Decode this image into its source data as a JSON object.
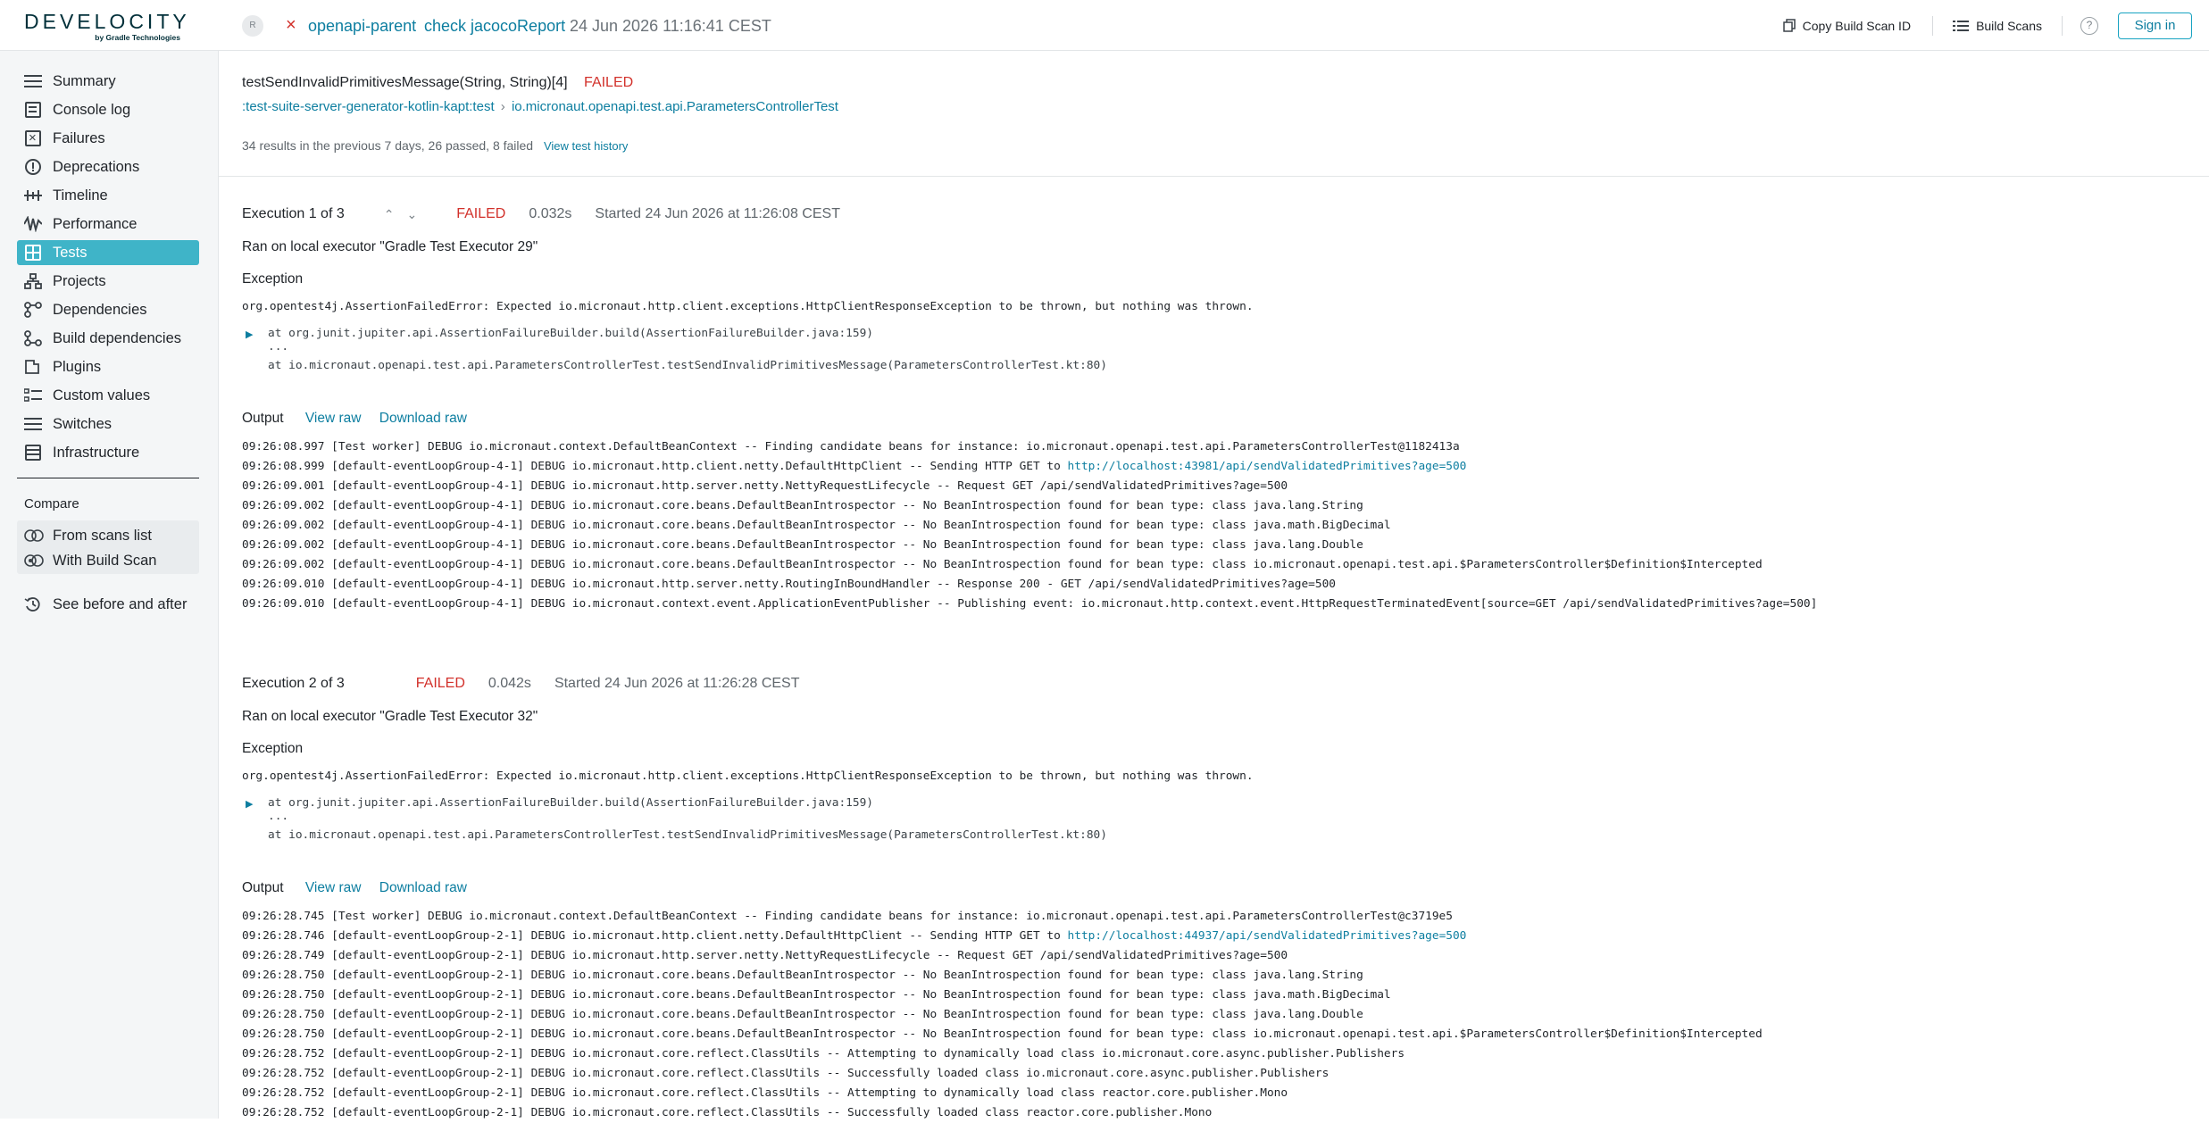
{
  "header": {
    "logo_text": "DEVELOCITY",
    "logo_sub": "by Gradle Technologies",
    "avatar": "R",
    "project": "openapi-parent",
    "tasks": "check jacocoReport",
    "timestamp": "24 Jun 2026 11:16:41 CEST",
    "copy_id": "Copy Build Scan ID",
    "build_scans": "Build Scans",
    "help": "?",
    "sign_in": "Sign in"
  },
  "sidebar": {
    "items": [
      {
        "label": "Summary",
        "icon": "summary-icon"
      },
      {
        "label": "Console log",
        "icon": "console-log-icon"
      },
      {
        "label": "Failures",
        "icon": "failures-icon"
      },
      {
        "label": "Deprecations",
        "icon": "deprecations-icon"
      },
      {
        "label": "Timeline",
        "icon": "timeline-icon"
      },
      {
        "label": "Performance",
        "icon": "performance-icon"
      },
      {
        "label": "Tests",
        "icon": "tests-icon"
      },
      {
        "label": "Projects",
        "icon": "projects-icon"
      },
      {
        "label": "Dependencies",
        "icon": "dependencies-icon"
      },
      {
        "label": "Build dependencies",
        "icon": "build-dependencies-icon"
      },
      {
        "label": "Plugins",
        "icon": "plugins-icon"
      },
      {
        "label": "Custom values",
        "icon": "custom-values-icon"
      },
      {
        "label": "Switches",
        "icon": "switches-icon"
      },
      {
        "label": "Infrastructure",
        "icon": "infrastructure-icon"
      }
    ],
    "active": "Tests",
    "compare": {
      "label": "Compare",
      "from_list": "From scans list",
      "with_scan": "With Build Scan",
      "before_after": "See before and after"
    }
  },
  "test": {
    "name": "testSendInvalidPrimitivesMessage(String, String)[4]",
    "status": "FAILED",
    "task_path": ":test-suite-server-generator-kotlin-kapt:test",
    "class_path": "io.micronaut.openapi.test.api.ParametersControllerTest",
    "history": "34 results in the previous 7 days, 26 passed, 8 failed",
    "history_link": "View test history"
  },
  "executions": [
    {
      "title": "Execution 1 of 3",
      "status": "FAILED",
      "duration": "0.032s",
      "started": "Started 24 Jun 2026 at 11:26:08 CEST",
      "executor": "Ran on local executor \"Gradle Test Executor 29\"",
      "exception_label": "Exception",
      "exception": "org.opentest4j.AssertionFailedError: Expected io.micronaut.http.client.exceptions.HttpClientResponseException to be thrown, but nothing was thrown.",
      "stack1": "at org.junit.jupiter.api.AssertionFailureBuilder.build(AssertionFailureBuilder.java:159)",
      "stack_ellipsis": "...",
      "stack2": "at io.micronaut.openapi.test.api.ParametersControllerTest.testSendInvalidPrimitivesMessage(ParametersControllerTest.kt:80)",
      "output_label": "Output",
      "view_raw": "View raw",
      "download_raw": "Download raw",
      "log": [
        {
          "pre": "09:26:08.997 [Test worker] DEBUG io.micronaut.context.DefaultBeanContext -- Finding candidate beans for instance: io.micronaut.openapi.test.api.ParametersControllerTest@1182413a",
          "link": "",
          "post": ""
        },
        {
          "pre": "09:26:08.999 [default-eventLoopGroup-4-1] DEBUG io.micronaut.http.client.netty.DefaultHttpClient -- Sending HTTP GET to ",
          "link": "http://localhost:43981/api/sendValidatedPrimitives?age=500",
          "post": ""
        },
        {
          "pre": "09:26:09.001 [default-eventLoopGroup-4-1] DEBUG io.micronaut.http.server.netty.NettyRequestLifecycle -- Request GET /api/sendValidatedPrimitives?age=500",
          "link": "",
          "post": ""
        },
        {
          "pre": "09:26:09.002 [default-eventLoopGroup-4-1] DEBUG io.micronaut.core.beans.DefaultBeanIntrospector -- No BeanIntrospection found for bean type: class java.lang.String",
          "link": "",
          "post": ""
        },
        {
          "pre": "09:26:09.002 [default-eventLoopGroup-4-1] DEBUG io.micronaut.core.beans.DefaultBeanIntrospector -- No BeanIntrospection found for bean type: class java.math.BigDecimal",
          "link": "",
          "post": ""
        },
        {
          "pre": "09:26:09.002 [default-eventLoopGroup-4-1] DEBUG io.micronaut.core.beans.DefaultBeanIntrospector -- No BeanIntrospection found for bean type: class java.lang.Double",
          "link": "",
          "post": ""
        },
        {
          "pre": "09:26:09.002 [default-eventLoopGroup-4-1] DEBUG io.micronaut.core.beans.DefaultBeanIntrospector -- No BeanIntrospection found for bean type: class io.micronaut.openapi.test.api.$ParametersController$Definition$Intercepted",
          "link": "",
          "post": ""
        },
        {
          "pre": "09:26:09.010 [default-eventLoopGroup-4-1] DEBUG io.micronaut.http.server.netty.RoutingInBoundHandler -- Response 200 - GET /api/sendValidatedPrimitives?age=500",
          "link": "",
          "post": ""
        },
        {
          "pre": "09:26:09.010 [default-eventLoopGroup-4-1] DEBUG io.micronaut.context.event.ApplicationEventPublisher -- Publishing event: io.micronaut.http.context.event.HttpRequestTerminatedEvent[source=GET /api/sendValidatedPrimitives?age=500]",
          "link": "",
          "post": ""
        }
      ]
    },
    {
      "title": "Execution 2 of 3",
      "status": "FAILED",
      "duration": "0.042s",
      "started": "Started 24 Jun 2026 at 11:26:28 CEST",
      "executor": "Ran on local executor \"Gradle Test Executor 32\"",
      "exception_label": "Exception",
      "exception": "org.opentest4j.AssertionFailedError: Expected io.micronaut.http.client.exceptions.HttpClientResponseException to be thrown, but nothing was thrown.",
      "stack1": "at org.junit.jupiter.api.AssertionFailureBuilder.build(AssertionFailureBuilder.java:159)",
      "stack_ellipsis": "...",
      "stack2": "at io.micronaut.openapi.test.api.ParametersControllerTest.testSendInvalidPrimitivesMessage(ParametersControllerTest.kt:80)",
      "output_label": "Output",
      "view_raw": "View raw",
      "download_raw": "Download raw",
      "log": [
        {
          "pre": "09:26:28.745 [Test worker] DEBUG io.micronaut.context.DefaultBeanContext -- Finding candidate beans for instance: io.micronaut.openapi.test.api.ParametersControllerTest@c3719e5",
          "link": "",
          "post": ""
        },
        {
          "pre": "09:26:28.746 [default-eventLoopGroup-2-1] DEBUG io.micronaut.http.client.netty.DefaultHttpClient -- Sending HTTP GET to ",
          "link": "http://localhost:44937/api/sendValidatedPrimitives?age=500",
          "post": ""
        },
        {
          "pre": "09:26:28.749 [default-eventLoopGroup-2-1] DEBUG io.micronaut.http.server.netty.NettyRequestLifecycle -- Request GET /api/sendValidatedPrimitives?age=500",
          "link": "",
          "post": ""
        },
        {
          "pre": "09:26:28.750 [default-eventLoopGroup-2-1] DEBUG io.micronaut.core.beans.DefaultBeanIntrospector -- No BeanIntrospection found for bean type: class java.lang.String",
          "link": "",
          "post": ""
        },
        {
          "pre": "09:26:28.750 [default-eventLoopGroup-2-1] DEBUG io.micronaut.core.beans.DefaultBeanIntrospector -- No BeanIntrospection found for bean type: class java.math.BigDecimal",
          "link": "",
          "post": ""
        },
        {
          "pre": "09:26:28.750 [default-eventLoopGroup-2-1] DEBUG io.micronaut.core.beans.DefaultBeanIntrospector -- No BeanIntrospection found for bean type: class java.lang.Double",
          "link": "",
          "post": ""
        },
        {
          "pre": "09:26:28.750 [default-eventLoopGroup-2-1] DEBUG io.micronaut.core.beans.DefaultBeanIntrospector -- No BeanIntrospection found for bean type: class io.micronaut.openapi.test.api.$ParametersController$Definition$Intercepted",
          "link": "",
          "post": ""
        },
        {
          "pre": "09:26:28.752 [default-eventLoopGroup-2-1] DEBUG io.micronaut.core.reflect.ClassUtils -- Attempting to dynamically load class io.micronaut.core.async.publisher.Publishers",
          "link": "",
          "post": ""
        },
        {
          "pre": "09:26:28.752 [default-eventLoopGroup-2-1] DEBUG io.micronaut.core.reflect.ClassUtils -- Successfully loaded class io.micronaut.core.async.publisher.Publishers",
          "link": "",
          "post": ""
        },
        {
          "pre": "09:26:28.752 [default-eventLoopGroup-2-1] DEBUG io.micronaut.core.reflect.ClassUtils -- Attempting to dynamically load class reactor.core.publisher.Mono",
          "link": "",
          "post": ""
        },
        {
          "pre": "09:26:28.752 [default-eventLoopGroup-2-1] DEBUG io.micronaut.core.reflect.ClassUtils -- Successfully loaded class reactor.core.publisher.Mono",
          "link": "",
          "post": ""
        }
      ]
    }
  ],
  "colors": {
    "accent": "#0d7ea0",
    "active_nav": "#3fb4c8",
    "failed": "#d2312b"
  }
}
